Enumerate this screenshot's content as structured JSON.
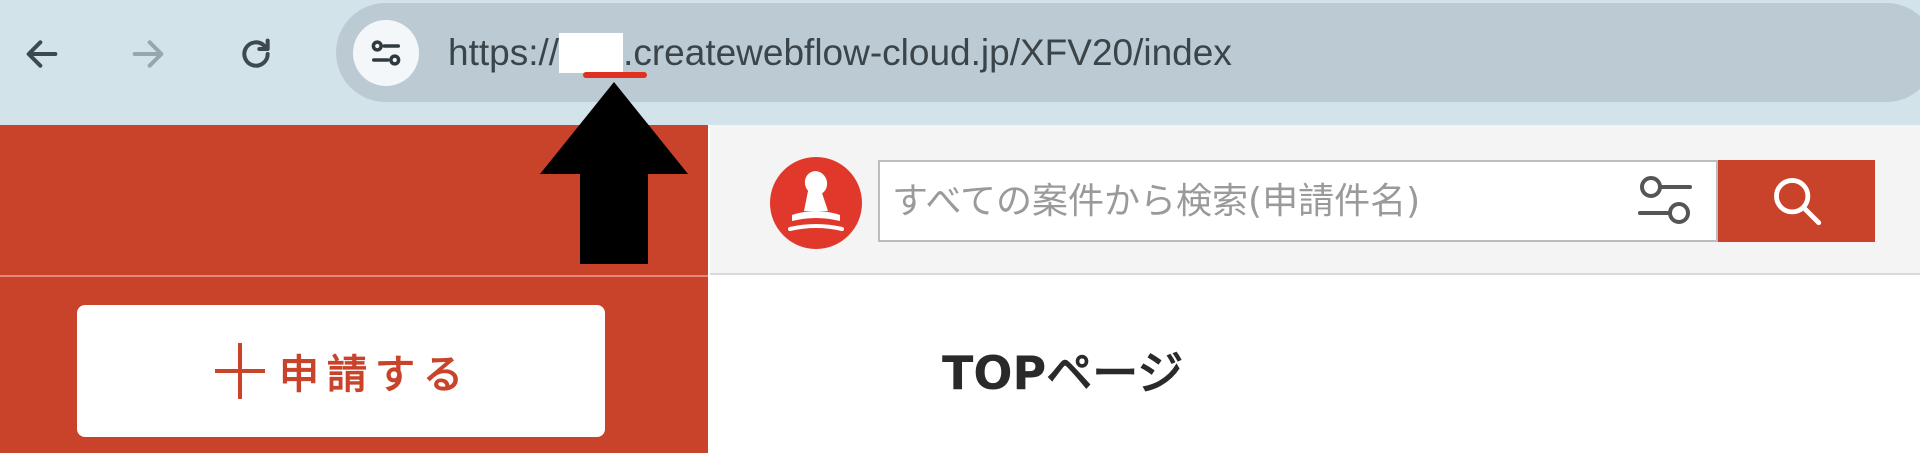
{
  "browser": {
    "url_prefix": "https://",
    "url_suffix": ".createwebflow-cloud.jp/XFV20/index",
    "icons": [
      "back-arrow-icon",
      "forward-arrow-icon",
      "reload-icon",
      "site-settings-icon"
    ]
  },
  "sidebar": {
    "apply_label": "申請する",
    "apply_icon": "plus-icon",
    "color": "#c9432b"
  },
  "header": {
    "logo_icon": "stamp-logo-icon",
    "search_placeholder": "すべての案件から検索(申請件名)",
    "filter_icon": "filter-sliders-icon",
    "search_icon": "search-icon"
  },
  "main": {
    "page_title": "TOPページ"
  },
  "annotation": {
    "arrow_icon": "up-arrow-icon",
    "redaction_mark_color": "#e03020"
  }
}
